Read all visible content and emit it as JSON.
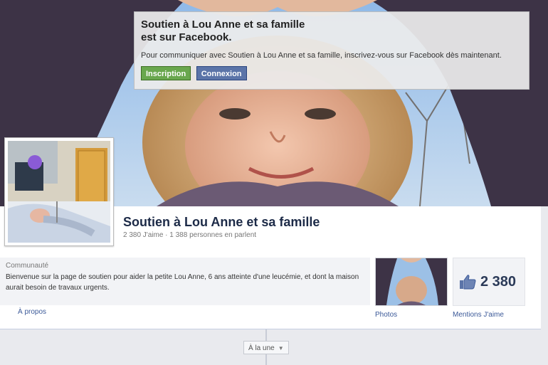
{
  "signup": {
    "title_line1": "Soutien à Lou Anne et sa famille",
    "title_line2": "est sur Facebook.",
    "description": "Pour communiquer avec Soutien à Lou Anne et sa famille, inscrivez-vous sur Facebook dès maintenant.",
    "signup_label": "Inscription",
    "login_label": "Connexion"
  },
  "page": {
    "name": "Soutien à Lou Anne et sa famille",
    "stats": "2 380 J'aime · 1 388 personnes en parlent",
    "category": "Communauté",
    "about_text": "Bienvenue sur la page de soutien pour aider la petite Lou Anne, 6 ans atteinte d'une leucémie, et dont la maison aurait besoin de travaux urgents.",
    "about_link": "À propos",
    "photos_label": "Photos",
    "likes_count": "2 380",
    "likes_label": "Mentions J'aime"
  },
  "timeline": {
    "button_label": "À la une"
  },
  "colors": {
    "accent_blue": "#3b5998",
    "signup_green": "#69a74e",
    "login_blue": "#5b74a8"
  }
}
